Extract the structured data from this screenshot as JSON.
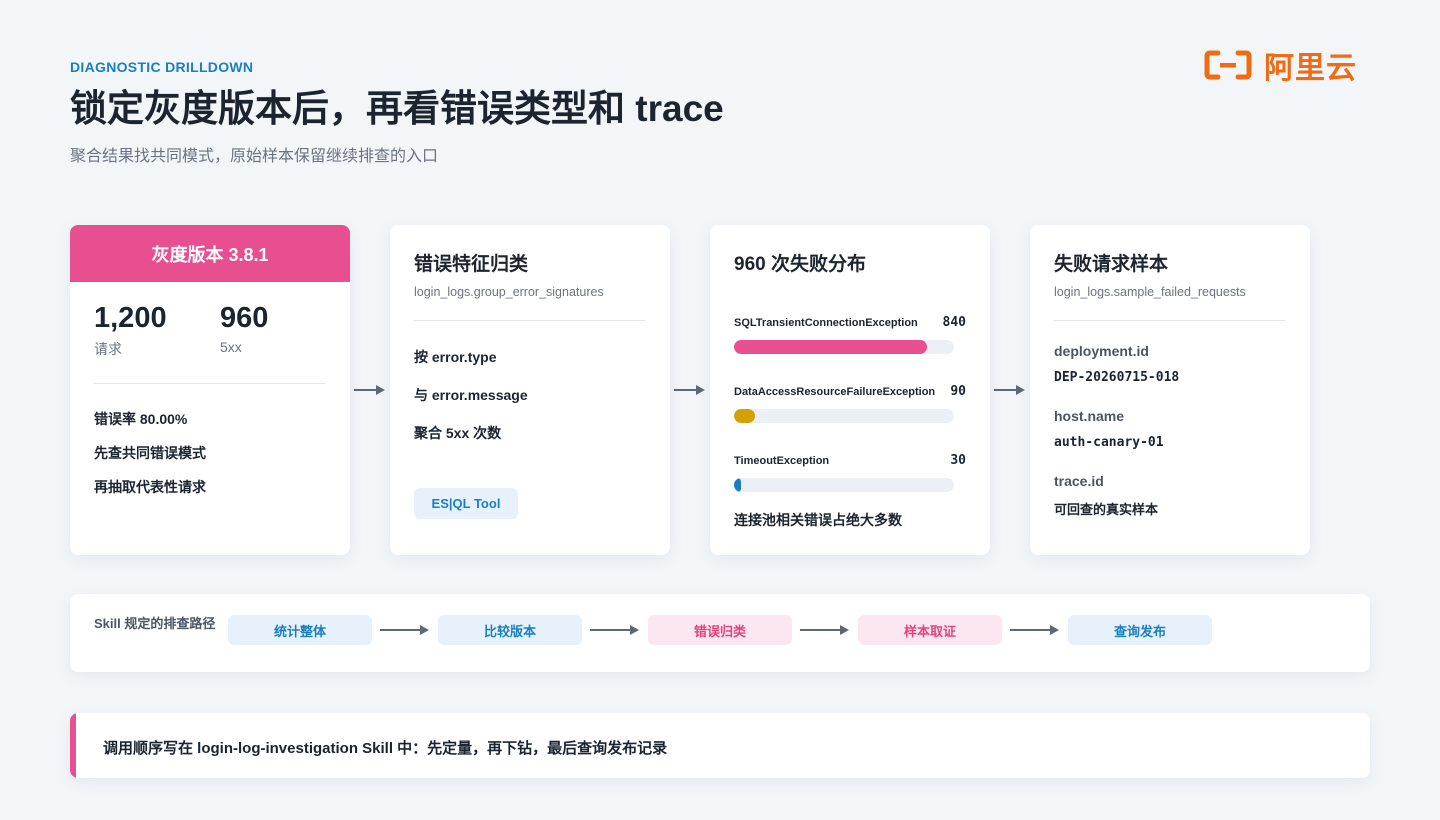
{
  "header": {
    "eyebrow": "DIAGNOSTIC DRILLDOWN",
    "title": "锁定灰度版本后，再看错误类型和 trace",
    "subtitle": "聚合结果找共同模式，原始样本保留继续排查的入口",
    "logo_text": "阿里云",
    "logo_color": "#f06b14"
  },
  "version_card": {
    "title": "灰度版本 3.8.1",
    "accent": "#e84f90",
    "stats": [
      {
        "value": "1,200",
        "label": "请求"
      },
      {
        "value": "960",
        "label": "5xx"
      }
    ],
    "lines": [
      "错误率 80.00%",
      "先查共同错误模式",
      "再抽取代表性请求"
    ]
  },
  "classify_card": {
    "title": "错误特征归类",
    "subtitle": "login_logs.group_error_signatures",
    "lines": [
      "按 error.type",
      "与 error.message",
      "聚合 5xx 次数"
    ],
    "tool": "ES|QL Tool"
  },
  "distribution_card": {
    "title": "960 次失败分布",
    "total": 960,
    "bars": [
      {
        "label": "SQLTransientConnectionException",
        "value": "840",
        "count": 840,
        "color": "#e84f90"
      },
      {
        "label": "DataAccessResourceFailureException",
        "value": "90",
        "count": 90,
        "color": "#d4a005"
      },
      {
        "label": "TimeoutException",
        "value": "30",
        "count": 30,
        "color": "#1a7fc1"
      }
    ],
    "footer": "连接池相关错误占绝大多数"
  },
  "sample_card": {
    "title": "失败请求样本",
    "subtitle": "login_logs.sample_failed_requests",
    "fields": [
      {
        "key": "deployment.id",
        "value": "DEP-20260715-018"
      },
      {
        "key": "host.name",
        "value": "auth-canary-01"
      },
      {
        "key": "trace.id",
        "value": "可回查的真实样本"
      }
    ]
  },
  "path": {
    "title": "Skill 规定的排查路径",
    "steps": [
      {
        "label": "统计整体",
        "tone": "blue"
      },
      {
        "label": "比较版本",
        "tone": "blue"
      },
      {
        "label": "错误归类",
        "tone": "pink"
      },
      {
        "label": "样本取证",
        "tone": "pink"
      },
      {
        "label": "查询发布",
        "tone": "blue"
      }
    ]
  },
  "note": {
    "text": "调用顺序写在 login-log-investigation Skill 中：先定量，再下钻，最后查询发布记录"
  }
}
